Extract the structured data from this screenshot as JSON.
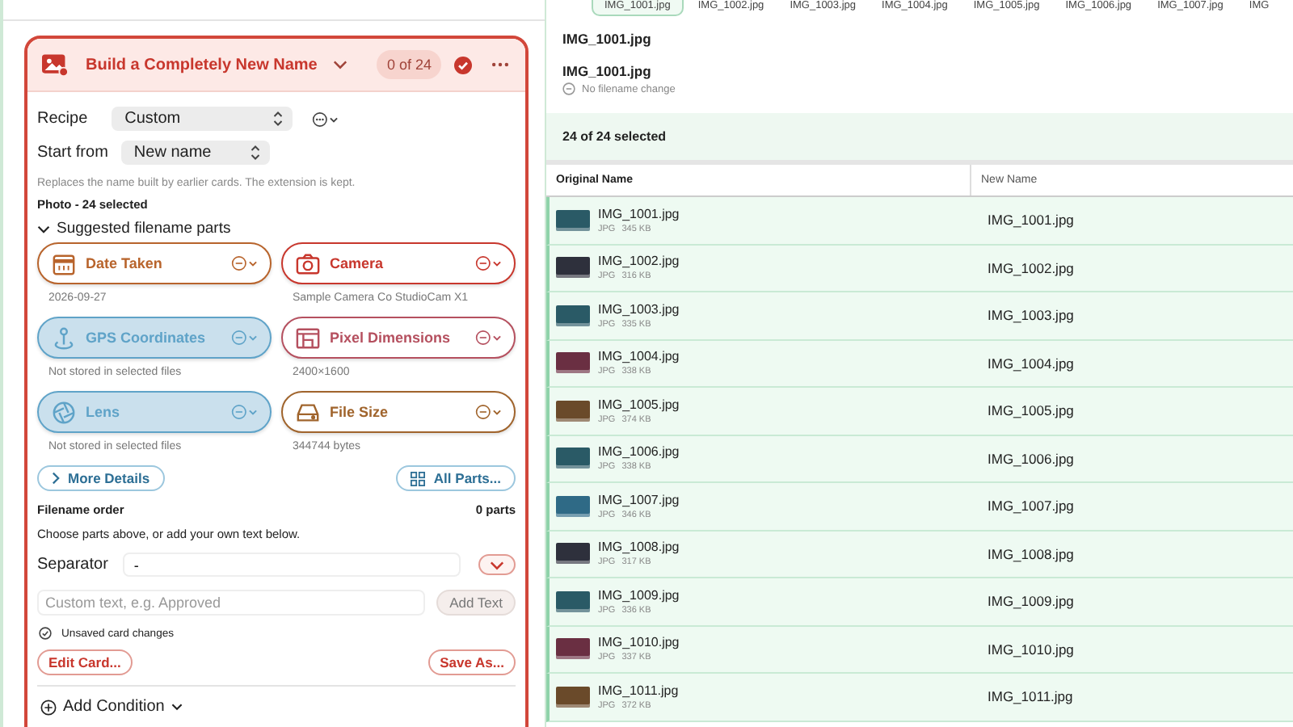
{
  "thumbnail_strip": [
    {
      "label": "IMG_1001.jpg",
      "selected": true
    },
    {
      "label": "IMG_1002.jpg",
      "selected": false
    },
    {
      "label": "IMG_1003.jpg",
      "selected": false
    },
    {
      "label": "IMG_1004.jpg",
      "selected": false
    },
    {
      "label": "IMG_1005.jpg",
      "selected": false
    },
    {
      "label": "IMG_1006.jpg",
      "selected": false
    },
    {
      "label": "IMG_1007.jpg",
      "selected": false
    },
    {
      "label": "IMG",
      "selected": false
    }
  ],
  "rule_card": {
    "title": "Build a Completely New Name",
    "count": "0 of 24",
    "recipe": {
      "label": "Recipe",
      "value": "Custom"
    },
    "start_from": {
      "label": "Start from",
      "value": "New name"
    },
    "hint": "Replaces the name built by earlier cards. The extension is kept.",
    "selection": "Photo - 24 selected",
    "suggested": {
      "title": "Suggested filename parts",
      "expanded": true,
      "parts": [
        {
          "kind": "calendar",
          "label": "Date Taken",
          "caption": "2026-09-27",
          "color": "#b8642c",
          "available": true
        },
        {
          "kind": "camera",
          "label": "Camera",
          "caption": "Sample Camera Co StudioCam X1",
          "color": "#c8372d",
          "available": true
        },
        {
          "kind": "pin",
          "label": "GPS Coordinates",
          "caption": "Not stored in selected files",
          "color": "#5fa3c8",
          "available": false
        },
        {
          "kind": "frame",
          "label": "Pixel Dimensions",
          "caption": "2400×1600",
          "color": "#b5505f",
          "available": true
        },
        {
          "kind": "aperture",
          "label": "Lens",
          "caption": "Not stored in selected files",
          "color": "#5fa3c8",
          "available": false
        },
        {
          "kind": "drive",
          "label": "File Size",
          "caption": "344744 bytes",
          "color": "#a0642c",
          "available": true
        }
      ]
    },
    "more_details": "More Details",
    "all_parts": "All Parts...",
    "order": {
      "label": "Filename order",
      "count": "0 parts",
      "hint": "Choose parts above, or add your own text below."
    },
    "separator": {
      "label": "Separator",
      "value": "-"
    },
    "custom_text": {
      "placeholder": "Custom text, e.g. Approved",
      "button": "Add Text"
    },
    "status": "Unsaved card changes",
    "buttons": [
      "Edit Card...",
      "Save As..."
    ],
    "add_condition": "Add Condition"
  },
  "preview": {
    "original": "IMG_1001.jpg",
    "new": "IMG_1001.jpg",
    "status": "No filename change"
  },
  "selection_summary": "24 of 24 selected",
  "table": {
    "columns": [
      "Original Name",
      "New Name"
    ],
    "rows": [
      {
        "name": "IMG_1001.jpg",
        "type": "JPG",
        "size": "345 KB",
        "new_name": "IMG_1001.jpg",
        "color": "#2a5a66",
        "selected": true
      },
      {
        "name": "IMG_1002.jpg",
        "type": "JPG",
        "size": "316 KB",
        "new_name": "IMG_1002.jpg",
        "color": "#2e303c",
        "selected": true
      },
      {
        "name": "IMG_1003.jpg",
        "type": "JPG",
        "size": "335 KB",
        "new_name": "IMG_1003.jpg",
        "color": "#2a5a66",
        "selected": true
      },
      {
        "name": "IMG_1004.jpg",
        "type": "JPG",
        "size": "338 KB",
        "new_name": "IMG_1004.jpg",
        "color": "#6a2f42",
        "selected": true
      },
      {
        "name": "IMG_1005.jpg",
        "type": "JPG",
        "size": "374 KB",
        "new_name": "IMG_1005.jpg",
        "color": "#6a4a2a",
        "selected": true
      },
      {
        "name": "IMG_1006.jpg",
        "type": "JPG",
        "size": "338 KB",
        "new_name": "IMG_1006.jpg",
        "color": "#2a5a66",
        "selected": true
      },
      {
        "name": "IMG_1007.jpg",
        "type": "JPG",
        "size": "346 KB",
        "new_name": "IMG_1007.jpg",
        "color": "#2f6a86",
        "selected": true
      },
      {
        "name": "IMG_1008.jpg",
        "type": "JPG",
        "size": "317 KB",
        "new_name": "IMG_1008.jpg",
        "color": "#2e303c",
        "selected": true
      },
      {
        "name": "IMG_1009.jpg",
        "type": "JPG",
        "size": "336 KB",
        "new_name": "IMG_1009.jpg",
        "color": "#2a5a66",
        "selected": true
      },
      {
        "name": "IMG_1010.jpg",
        "type": "JPG",
        "size": "337 KB",
        "new_name": "IMG_1010.jpg",
        "color": "#6a2f42",
        "selected": true
      },
      {
        "name": "IMG_1011.jpg",
        "type": "JPG",
        "size": "372 KB",
        "new_name": "IMG_1011.jpg",
        "color": "#6a4a2a",
        "selected": true
      }
    ]
  }
}
